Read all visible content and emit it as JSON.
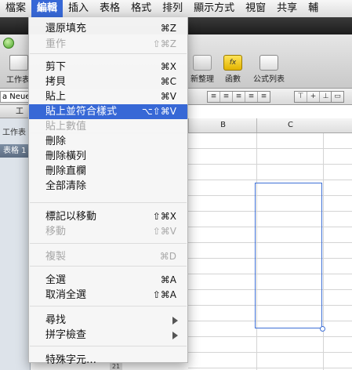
{
  "menubar": {
    "items": [
      {
        "label": "檔案",
        "active": false
      },
      {
        "label": "編輯",
        "active": true
      },
      {
        "label": "插入",
        "active": false
      },
      {
        "label": "表格",
        "active": false
      },
      {
        "label": "格式",
        "active": false
      },
      {
        "label": "排列",
        "active": false
      },
      {
        "label": "顯示方式",
        "active": false
      },
      {
        "label": "視窗",
        "active": false
      },
      {
        "label": "共享",
        "active": false
      },
      {
        "label": "輔",
        "active": false
      }
    ]
  },
  "toolbar": {
    "left_label": "工作表",
    "sort_label": "新整理",
    "function_label": "函數",
    "function_icon_text": "fx",
    "formula_list_label": "公式列表"
  },
  "formatbar": {
    "font": "a Neue"
  },
  "sidebar": {
    "tab_label": "工作",
    "sheet_label": "工作表",
    "table_label": "表格 1"
  },
  "grid": {
    "columns": [
      "B",
      "C"
    ],
    "row_number_visible": "21"
  },
  "edit_menu": {
    "items": [
      {
        "label": "還原填充",
        "shortcut": "⌘Z",
        "enabled": true,
        "highlighted": false,
        "submenu": false
      },
      {
        "label": "重作",
        "shortcut": "⇧⌘Z",
        "enabled": false,
        "highlighted": false,
        "submenu": false
      },
      {
        "label": "剪下",
        "shortcut": "⌘X",
        "enabled": true,
        "highlighted": false,
        "submenu": false
      },
      {
        "label": "拷貝",
        "shortcut": "⌘C",
        "enabled": true,
        "highlighted": false,
        "submenu": false
      },
      {
        "label": "貼上",
        "shortcut": "⌘V",
        "enabled": true,
        "highlighted": false,
        "submenu": false
      },
      {
        "label": "貼上並符合樣式",
        "shortcut": "⌥⇧⌘V",
        "enabled": true,
        "highlighted": true,
        "submenu": false
      },
      {
        "label": "貼上數值",
        "shortcut": "",
        "enabled": false,
        "highlighted": false,
        "submenu": false
      },
      {
        "label": "刪除",
        "shortcut": "",
        "enabled": true,
        "highlighted": false,
        "submenu": false
      },
      {
        "label": "刪除橫列",
        "shortcut": "",
        "enabled": true,
        "highlighted": false,
        "submenu": false
      },
      {
        "label": "刪除直欄",
        "shortcut": "",
        "enabled": true,
        "highlighted": false,
        "submenu": false
      },
      {
        "label": "全部清除",
        "shortcut": "",
        "enabled": true,
        "highlighted": false,
        "submenu": false
      },
      {
        "label": "標記以移動",
        "shortcut": "⇧⌘X",
        "enabled": true,
        "highlighted": false,
        "submenu": false
      },
      {
        "label": "移動",
        "shortcut": "⇧⌘V",
        "enabled": false,
        "highlighted": false,
        "submenu": false
      },
      {
        "label": "複製",
        "shortcut": "⌘D",
        "enabled": false,
        "highlighted": false,
        "submenu": false
      },
      {
        "label": "全選",
        "shortcut": "⌘A",
        "enabled": true,
        "highlighted": false,
        "submenu": false
      },
      {
        "label": "取消全選",
        "shortcut": "⇧⌘A",
        "enabled": true,
        "highlighted": false,
        "submenu": false
      },
      {
        "label": "尋找",
        "shortcut": "",
        "enabled": true,
        "highlighted": false,
        "submenu": true
      },
      {
        "label": "拼字檢查",
        "shortcut": "",
        "enabled": true,
        "highlighted": false,
        "submenu": true
      },
      {
        "label": "特殊字元…",
        "shortcut": "",
        "enabled": true,
        "highlighted": false,
        "submenu": false
      }
    ]
  },
  "colors": {
    "highlight": "#3768d6",
    "disabled_text": "#a8a8a8",
    "selection_border": "#3d6fd6"
  }
}
